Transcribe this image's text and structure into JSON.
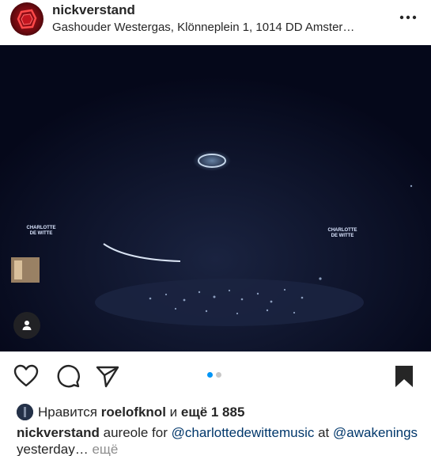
{
  "post": {
    "username": "nickverstand",
    "location": "Gashouder Westergas, Klönneplein 1, 1014 DD Amster…",
    "more_icon": "more-horizontal-icon"
  },
  "media": {
    "stage_sign_left": "CHARLOTTE DE WITTE",
    "stage_sign_right": "CHARLOTTE DE WITTE",
    "tag_icon": "user-tag-icon"
  },
  "actions": {
    "like_icon": "heart-icon",
    "comment_icon": "comment-icon",
    "share_icon": "paper-plane-icon",
    "save_icon": "bookmark-icon",
    "carousel_pages": 2,
    "carousel_active": 1,
    "colors": {
      "active_dot": "#0095f6",
      "inactive_dot": "#c7c7c7"
    }
  },
  "likes": {
    "prefix": "Нравится",
    "user": "roelofknol",
    "conj": "и",
    "rest": "ещё 1 885"
  },
  "caption": {
    "username": "nickverstand",
    "text1": "aureole for",
    "mention1": "@charlottedewittemusic",
    "text2": "at",
    "mention2": "@awakenings",
    "text3": "yesterday…",
    "more": "ещё"
  }
}
